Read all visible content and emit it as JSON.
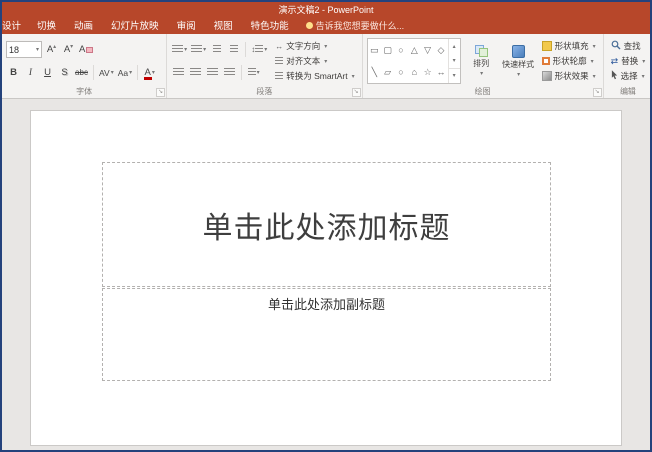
{
  "window": {
    "title": "演示文稿2 - PowerPoint"
  },
  "colors": {
    "titlebar": "#b7472a",
    "window_border": "#24427c",
    "ribbon_bg": "#f4f3f2",
    "slide_bg": "#e8e6e4",
    "font_color_accent": "#c00000"
  },
  "tabs": {
    "partial": "设计",
    "items": [
      "切换",
      "动画",
      "幻灯片放映",
      "审阅",
      "视图",
      "特色功能"
    ],
    "tell_me": "告诉我您想要做什么..."
  },
  "font_group": {
    "label": "字体",
    "size_value": "18",
    "bold": "B",
    "italic": "I",
    "underline": "U",
    "shadow": "S",
    "strike": "abc",
    "spacing": "AV",
    "case": "Aa",
    "color": "A",
    "grow": "A",
    "shrink": "A",
    "clear": "A"
  },
  "paragraph_group": {
    "label": "段落",
    "text_direction": "文字方向",
    "align_text": "对齐文本",
    "smartart": "转换为 SmartArt"
  },
  "drawing_group": {
    "label": "绘图",
    "arrange": "排列",
    "quick_styles": "快速样式",
    "shape_fill": "形状填充",
    "shape_outline": "形状轮廓",
    "shape_effects": "形状效果",
    "shapes_row1": [
      "▭",
      "▢",
      "○",
      "△",
      "▽",
      "◇"
    ],
    "shapes_row2": [
      "╲",
      "▱",
      "○",
      "⌂",
      "☆",
      "↔"
    ]
  },
  "editing_group": {
    "label": "编辑",
    "find": "查找",
    "replace": "替换",
    "select": "选择"
  },
  "slide": {
    "title_placeholder": "单击此处添加标题",
    "subtitle_placeholder": "单击此处添加副标题"
  },
  "icons": {
    "dropdown": "▾",
    "up": "▴",
    "down": "▾",
    "more": "▾",
    "launcher": "↘",
    "updown": "↕",
    "leftright": "↔",
    "swap": "⇄"
  }
}
